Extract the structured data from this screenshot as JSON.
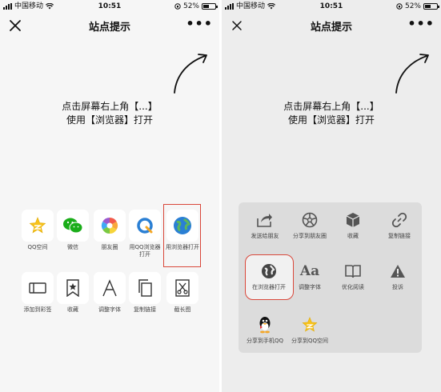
{
  "left_screen": {
    "status_bar": {
      "carrier": "中国移动",
      "time": "10:51",
      "battery": "52%",
      "battery_level": 0.52
    },
    "title": "站点提示",
    "tip_line1": "点击屏幕右上角【...】",
    "tip_line2": "使用【浏览器】打开",
    "share_row1": [
      {
        "label": "QQ空间",
        "icon": "qzone-star-icon"
      },
      {
        "label": "微信",
        "icon": "wechat-icon"
      },
      {
        "label": "朋友圈",
        "icon": "moments-icon"
      },
      {
        "label": "用QQ浏览器打开",
        "icon": "qq-browser-icon"
      },
      {
        "label": "用浏览器打开",
        "icon": "globe-icon"
      }
    ],
    "share_row2": [
      {
        "label": "添加到彩签",
        "icon": "tag-icon"
      },
      {
        "label": "收藏",
        "icon": "bookmark-star-icon"
      },
      {
        "label": "调整字体",
        "icon": "font-icon"
      },
      {
        "label": "复制链接",
        "icon": "copy-icon"
      },
      {
        "label": "截长图",
        "icon": "scissors-icon"
      }
    ]
  },
  "right_screen": {
    "status_bar": {
      "carrier": "中国移动",
      "time": "10:51",
      "battery": "52%",
      "battery_level": 0.52
    },
    "title": "站点提示",
    "tip_line1": "点击屏幕右上角【...】",
    "tip_line2": "使用【浏览器】打开",
    "menu_row1": [
      {
        "label": "发送给朋友",
        "icon": "forward-icon"
      },
      {
        "label": "分享到朋友圈",
        "icon": "moments-shutter-icon"
      },
      {
        "label": "收藏",
        "icon": "cube-icon"
      },
      {
        "label": "复制链接",
        "icon": "link-icon"
      }
    ],
    "menu_row2": [
      {
        "label": "在浏览器打开",
        "icon": "globe-icon"
      },
      {
        "label": "调整字体",
        "icon": "font-aa-icon"
      },
      {
        "label": "优化阅读",
        "icon": "book-icon"
      },
      {
        "label": "投诉",
        "icon": "warning-icon"
      }
    ],
    "menu_row3": [
      {
        "label": "分享到手机QQ",
        "icon": "qq-penguin-icon"
      },
      {
        "label": "分享到QQ空间",
        "icon": "qzone-star-icon"
      }
    ]
  },
  "colors": {
    "highlight": "#d9473a",
    "wechat_green": "#1aad19",
    "globe_blue": "#2a7fd4"
  }
}
